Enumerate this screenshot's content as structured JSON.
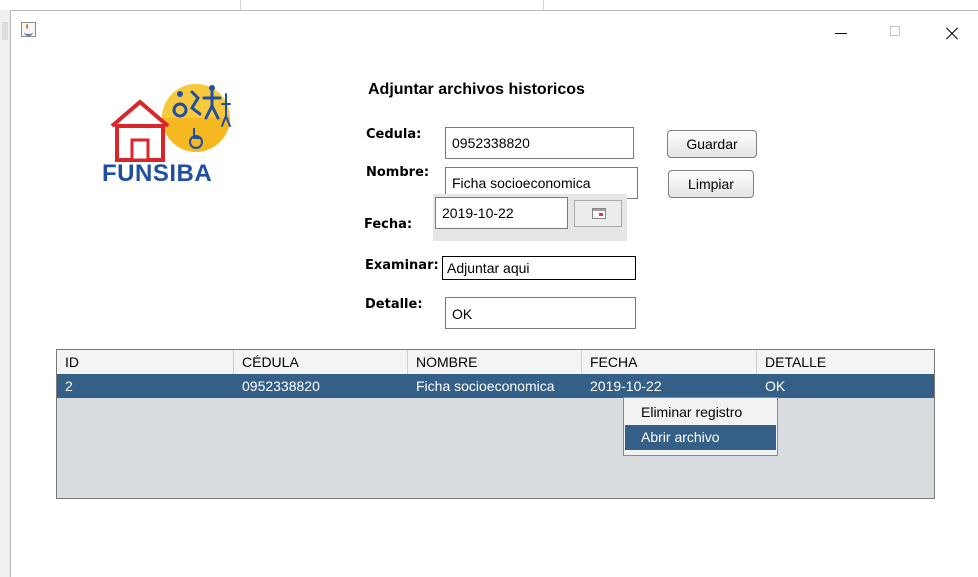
{
  "window": {
    "title": ""
  },
  "logo": {
    "name": "FUNSIBA"
  },
  "form": {
    "title": "Adjuntar archivos historicos",
    "cedula_label": "Cedula:",
    "cedula_value": "0952338820",
    "nombre_label": "Nombre:",
    "nombre_value": "Ficha socioeconomica",
    "fecha_label": "Fecha:",
    "fecha_value": "2019-10-22",
    "examinar_label": "Examinar:",
    "examinar_value": "Adjuntar aqui",
    "detalle_label": "Detalle:",
    "detalle_value": "OK"
  },
  "buttons": {
    "guardar": "Guardar",
    "limpiar": "Limpiar"
  },
  "table": {
    "columns": [
      "ID",
      "CÉDULA",
      "NOMBRE",
      "FECHA",
      "DETALLE"
    ],
    "rows": [
      [
        "2",
        "0952338820",
        "Ficha socioeconomica",
        "2019-10-22",
        "OK"
      ]
    ],
    "selected_row": 0
  },
  "context_menu": {
    "items": [
      "Eliminar registro",
      "Abrir archivo"
    ],
    "highlighted": 1
  },
  "colors": {
    "selection": "#345f87",
    "logo_text": "#1f4fa3",
    "logo_red": "#d9262a",
    "logo_sun": "#f5b820"
  }
}
